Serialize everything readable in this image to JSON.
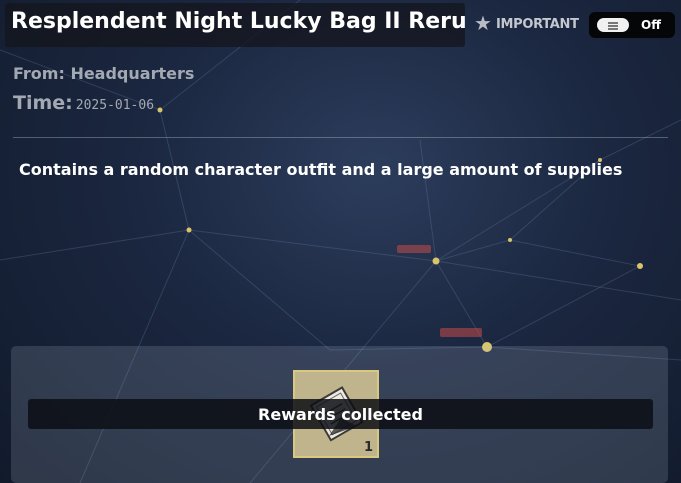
{
  "mail": {
    "title": "Resplendent Night Lucky Bag II Rerun",
    "important_label": "IMPORTANT",
    "toggle_state": "Off",
    "from_label": "From:",
    "from_value": "Headquarters",
    "time_label": "Time:",
    "time_value": "2025-01-06",
    "description": "Contains a random character outfit and a large amount of supplies"
  },
  "reward": {
    "item_icon": "outfit-bag-icon",
    "quantity": "1",
    "collected_label": "Rewards collected"
  },
  "colors": {
    "background": "#1b2740",
    "reward_card": "#bfb48c",
    "reward_border": "#d9c880"
  }
}
